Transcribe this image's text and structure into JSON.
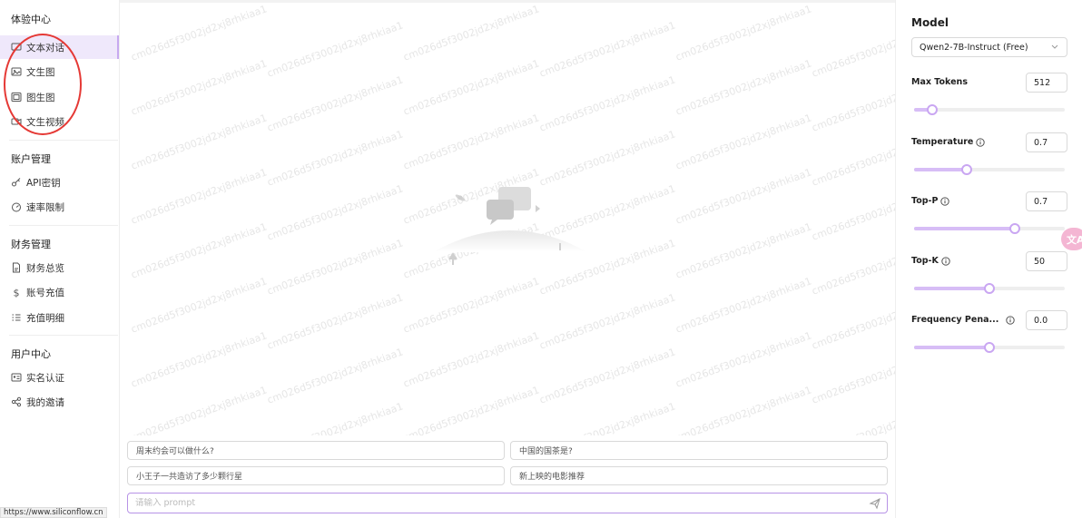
{
  "sidebar": {
    "groups": [
      {
        "title": "体验中心",
        "items": [
          {
            "label": "文本对话",
            "icon": "chat-icon",
            "active": true
          },
          {
            "label": "文生图",
            "icon": "image-icon"
          },
          {
            "label": "图生图",
            "icon": "images-icon"
          },
          {
            "label": "文生视频",
            "icon": "video-icon"
          }
        ]
      },
      {
        "title": "账户管理",
        "items": [
          {
            "label": "API密钥",
            "icon": "key-icon"
          },
          {
            "label": "速率限制",
            "icon": "gauge-icon"
          }
        ]
      },
      {
        "title": "财务管理",
        "items": [
          {
            "label": "财务总览",
            "icon": "document-icon"
          },
          {
            "label": "账号充值",
            "icon": "dollar-icon"
          },
          {
            "label": "充值明细",
            "icon": "list-icon"
          }
        ]
      },
      {
        "title": "用户中心",
        "items": [
          {
            "label": "实名认证",
            "icon": "id-card-icon"
          },
          {
            "label": "我的邀请",
            "icon": "share-icon"
          }
        ]
      }
    ]
  },
  "main": {
    "watermark": "cm026d5f3002jd2xj8rhkiaa1",
    "suggestions": [
      "周末约会可以做什么?",
      "中国的国茶是?",
      "小王子一共造访了多少颗行星",
      "新上映的电影推荐"
    ],
    "prompt_placeholder": "请输入 prompt"
  },
  "status_url": "https://www.siliconflow.cn",
  "panel": {
    "title": "Model",
    "model": "Qwen2-7B-Instruct (Free)",
    "params": [
      {
        "label": "Max Tokens",
        "value": "512",
        "info": false,
        "level": 0.12
      },
      {
        "label": "Temperature",
        "value": "0.7",
        "info": true,
        "level": 0.35
      },
      {
        "label": "Top-P",
        "value": "0.7",
        "info": true,
        "level": 0.67
      },
      {
        "label": "Top-K",
        "value": "50",
        "info": true,
        "level": 0.5
      },
      {
        "label": "Frequency Pena...",
        "value": "0.0",
        "info": true,
        "level": 0.5
      }
    ],
    "side_pill": "文A"
  },
  "colors": {
    "accent": "#b793e6",
    "active_bg": "#efe8fb",
    "slider_fill": "#d7bdf6",
    "annotation": "#e53935"
  }
}
